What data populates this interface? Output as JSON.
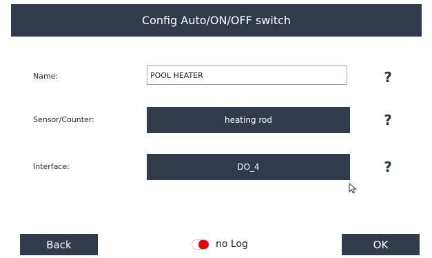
{
  "dialog": {
    "title": "Config Auto/ON/OFF switch"
  },
  "fields": {
    "name": {
      "label": "Name:",
      "value": "POOL HEATER"
    },
    "sensor": {
      "label": "Sensor/Counter:",
      "value": "heating rod"
    },
    "interface": {
      "label": "Interface:",
      "value": "DO_4"
    },
    "help_symbol": "?"
  },
  "footer": {
    "back_label": "Back",
    "ok_label": "OK",
    "log_toggle": {
      "label": "no Log",
      "state": "off",
      "knob_color": "#d40f0f"
    }
  },
  "colors": {
    "header_bg": "#323b4c",
    "button_bg": "#323b4c",
    "page_bg": "#ffffff"
  },
  "icons": {
    "help": "question-mark-icon",
    "pointer": "mouse-pointer-icon"
  }
}
